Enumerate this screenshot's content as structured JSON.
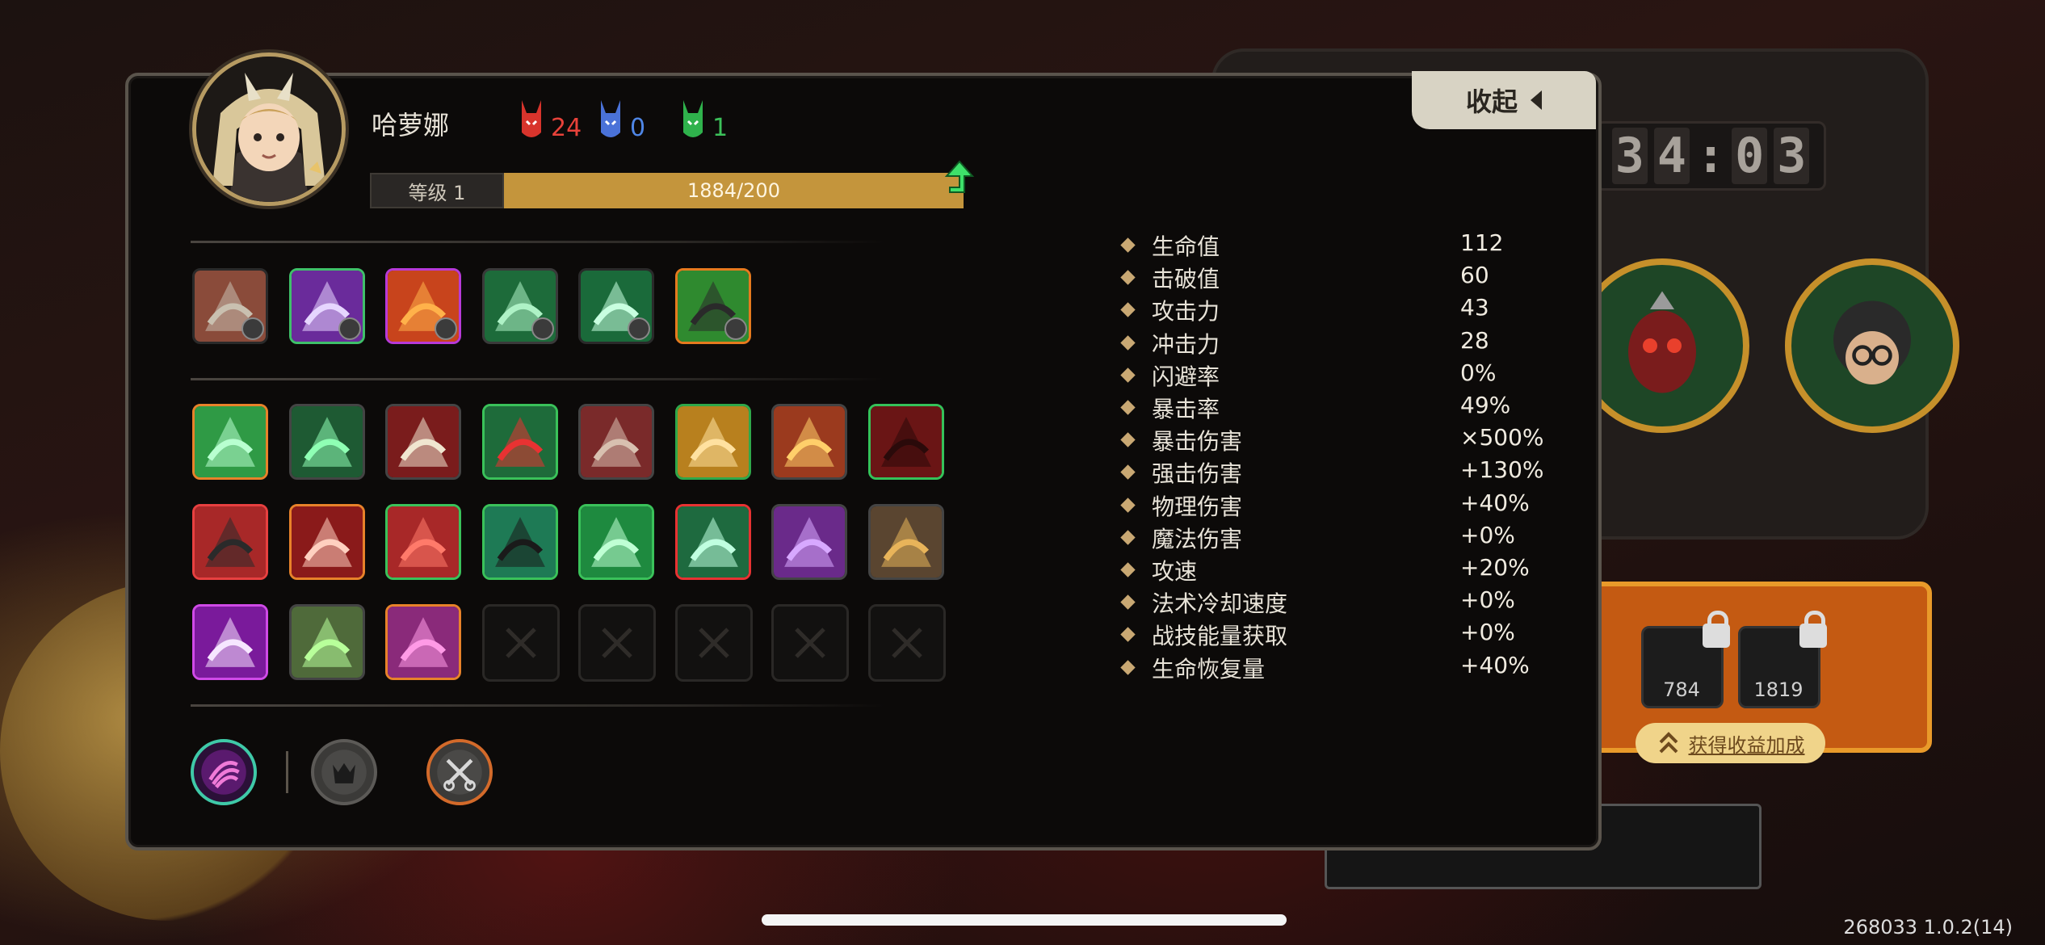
{
  "hero": {
    "name": "哈萝娜",
    "level_label": "等级 1",
    "exp_text": "1884/200",
    "exp_progress": 1.0
  },
  "currencies": [
    {
      "name": "red-demon-token",
      "value": "24",
      "color": "#e8423a"
    },
    {
      "name": "blue-demon-token",
      "value": "0",
      "color": "#4f86e6"
    },
    {
      "name": "green-demon-token",
      "value": "1",
      "color": "#3cc15a"
    }
  ],
  "collapse_button": {
    "label": "收起"
  },
  "stats": [
    {
      "label": "生命值",
      "value": "112"
    },
    {
      "label": "击破值",
      "value": "60"
    },
    {
      "label": "攻击力",
      "value": "43"
    },
    {
      "label": "冲击力",
      "value": "28"
    },
    {
      "label": "闪避率",
      "value": "0%"
    },
    {
      "label": "暴击率",
      "value": "49%"
    },
    {
      "label": "暴击伤害",
      "value": "×500%"
    },
    {
      "label": "强击伤害",
      "value": "+130%"
    },
    {
      "label": "物理伤害",
      "value": "+40%"
    },
    {
      "label": "魔法伤害",
      "value": "+0%"
    },
    {
      "label": "攻速",
      "value": "+20%"
    },
    {
      "label": "法术冷却速度",
      "value": "+0%"
    },
    {
      "label": "战技能量获取",
      "value": "+0%"
    },
    {
      "label": "生命恢复量",
      "value": "+40%"
    }
  ],
  "equipment_icons": [
    "claw-slash-icon",
    "purple-boot-icon",
    "fire-swirl-icon",
    "green-spike-icon",
    "green-crystal-icon",
    "green-syringe-icon"
  ],
  "talent_icons": [
    "green-vortex-icon",
    "green-burst-icon",
    "red-slash-icon",
    "red-arrow-icon",
    "demon-mask-icon",
    "golden-spikes-icon",
    "fire-gate-icon",
    "red-wolf-icon",
    "red-axe-icon",
    "red-fang-icon",
    "red-leaf-icon",
    "hooded-figure-icon",
    "green-shards-icon",
    "green-feathers-icon",
    "purple-dragon-icon",
    "gold-gear-icon",
    "purple-blade-icon",
    "green-legs-icon",
    "purple-fish-icon",
    "empty-slot-icon",
    "empty-slot-icon",
    "empty-slot-icon",
    "empty-slot-icon",
    "empty-slot-icon"
  ],
  "active_skills": [
    "purple-claw-skill-icon",
    "beast-skill-icon",
    "scissors-skill-icon"
  ],
  "hud": {
    "timer": [
      "3",
      "4",
      "0",
      "3"
    ],
    "resource_1": "784",
    "resource_2": "1819",
    "gain_button": "获得收益加成"
  },
  "version": "268033 1.0.2(14)"
}
